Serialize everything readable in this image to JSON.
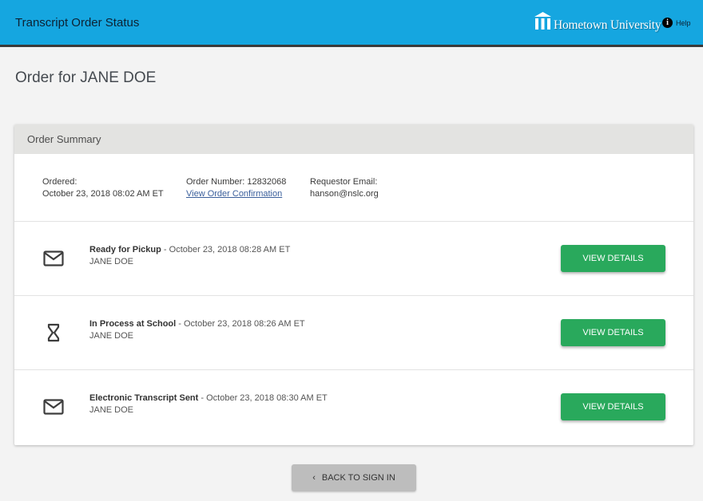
{
  "header": {
    "title": "Transcript Order Status",
    "brand_name": "Hometown University",
    "help_label": "Help",
    "help_icon": "info-icon",
    "brand_icon": "building-columns-icon"
  },
  "page": {
    "title": "Order for JANE DOE"
  },
  "order_summary": {
    "heading": "Order Summary",
    "ordered_label": "Ordered:",
    "ordered_value": "October 23, 2018 08:02 AM ET",
    "order_number_label": "Order Number: 12832068",
    "view_confirmation_link": "View Order Confirmation",
    "requestor_email_label": "Requestor Email:",
    "requestor_email_value": "hanson@nslc.org"
  },
  "events": [
    {
      "icon": "envelope-icon",
      "status": "Ready for Pickup",
      "timestamp": " - October 23, 2018 08:28 AM ET",
      "recipient": "JANE DOE",
      "button_label": "VIEW DETAILS"
    },
    {
      "icon": "hourglass-icon",
      "status": "In Process at School",
      "timestamp": " - October 23, 2018 08:26 AM ET",
      "recipient": "JANE DOE",
      "button_label": "VIEW DETAILS"
    },
    {
      "icon": "envelope-icon",
      "status": "Electronic Transcript Sent",
      "timestamp": " - October 23, 2018 08:30 AM ET",
      "recipient": "JANE DOE",
      "button_label": "VIEW DETAILS"
    }
  ],
  "footer": {
    "back_label": "BACK TO SIGN IN",
    "back_icon": "chevron-left-icon"
  },
  "colors": {
    "header_bg": "#15a6e0",
    "button_green": "#29a95c",
    "back_button_bg": "#bdbdbd",
    "link": "#3a5f9b"
  }
}
